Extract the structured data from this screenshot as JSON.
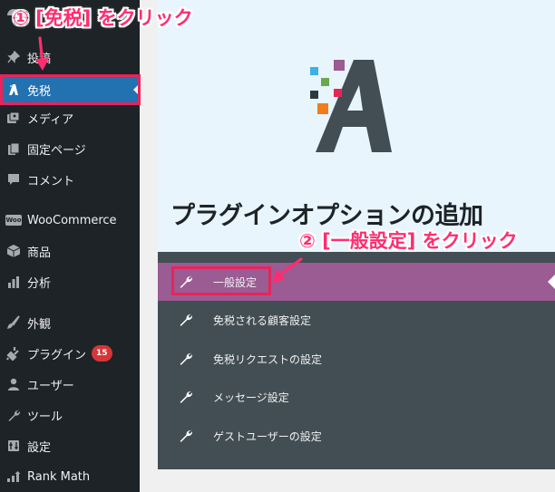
{
  "sidebar": {
    "items": [
      {
        "label": "投稿",
        "icon": "pin-icon"
      },
      {
        "label": "免税",
        "icon": "plugin-a-icon",
        "active": true
      },
      {
        "label": "メディア",
        "icon": "media-icon"
      },
      {
        "label": "固定ページ",
        "icon": "page-icon"
      },
      {
        "label": "コメント",
        "icon": "comment-icon"
      },
      {
        "label": "WooCommerce",
        "icon": "woo-icon"
      },
      {
        "label": "商品",
        "icon": "box-icon"
      },
      {
        "label": "分析",
        "icon": "chart-icon"
      },
      {
        "label": "外観",
        "icon": "brush-icon"
      },
      {
        "label": "プラグイン",
        "icon": "plugin-icon",
        "badge": "15"
      },
      {
        "label": "ユーザー",
        "icon": "user-icon"
      },
      {
        "label": "ツール",
        "icon": "wrench-icon"
      },
      {
        "label": "設定",
        "icon": "settings-icon"
      },
      {
        "label": "Rank Math",
        "icon": "rankmath-icon"
      }
    ],
    "woo_logo_text": "Woo"
  },
  "main": {
    "heading": "プラグインオプションの追加",
    "menu": [
      {
        "label": "一般設定",
        "active": true
      },
      {
        "label": "免税される顧客設定"
      },
      {
        "label": "免税リクエストの設定"
      },
      {
        "label": "メッセージ設定"
      },
      {
        "label": "ゲストユーザーの設定"
      }
    ]
  },
  "annotations": {
    "step1": "① [免税] をクリック",
    "step2": "② [一般設定] をクリック"
  },
  "colors": {
    "sidebar_bg": "#1d2327",
    "sidebar_active": "#2271b1",
    "hero_bg": "#e8f5fd",
    "plugin_menu_bg": "#424e54",
    "plugin_menu_active": "#9b5b93",
    "annotation": "#ff2d6f",
    "highlight_box": "#e8245a"
  }
}
